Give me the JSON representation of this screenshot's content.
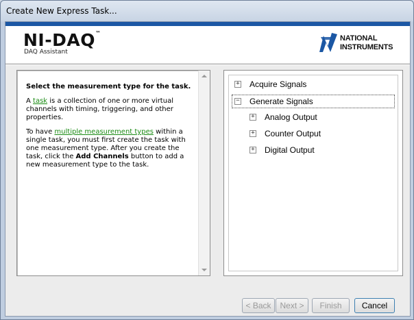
{
  "window": {
    "title": "Create New Express Task..."
  },
  "header": {
    "product": "NI-DAQ",
    "tm": "™",
    "subtitle": "DAQ Assistant",
    "vendor_line1": "NATIONAL",
    "vendor_line2": "INSTRUMENTS",
    "vendor_tm": "™",
    "brand_color": "#1b57a4"
  },
  "help": {
    "heading": "Select the measurement type for the task.",
    "p1_prefix": "A ",
    "p1_link": "task",
    "p1_suffix": " is a collection of one or more virtual channels with timing, triggering, and other properties.",
    "p2_prefix": "To have ",
    "p2_link": "multiple measurement types",
    "p2_mid": " within a single task, you must first create the task with one measurement type. After you create the task, click the ",
    "p2_bold": "Add Channels",
    "p2_suffix": " button to add a new measurement type to the task.",
    "link_color": "#198a12"
  },
  "tree": {
    "items": [
      {
        "label": "Acquire Signals",
        "expander": "+",
        "selected": false
      },
      {
        "label": "Generate Signals",
        "expander": "−",
        "selected": true
      },
      {
        "label": "Analog Output",
        "expander": "+",
        "selected": false
      },
      {
        "label": "Counter Output",
        "expander": "+",
        "selected": false
      },
      {
        "label": "Digital Output",
        "expander": "+",
        "selected": false
      }
    ]
  },
  "buttons": {
    "back": "< Back",
    "next": "Next >",
    "finish": "Finish",
    "cancel": "Cancel"
  }
}
